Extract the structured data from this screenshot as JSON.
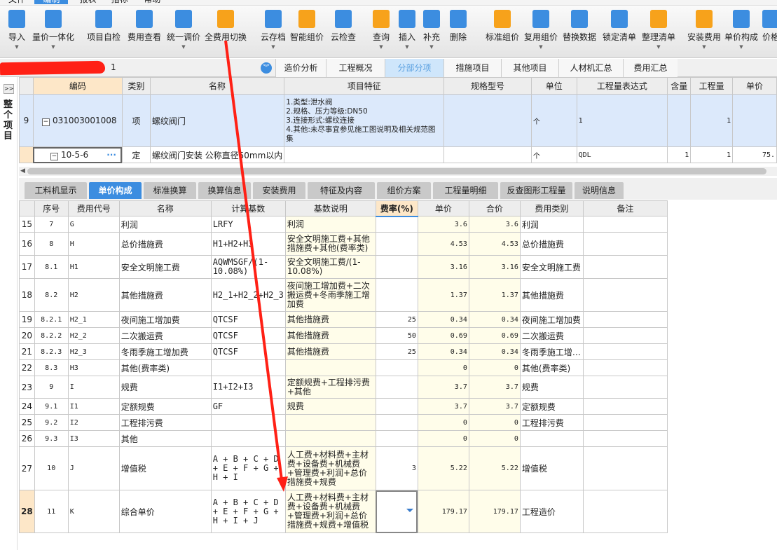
{
  "menu": [
    "文件",
    "编制",
    "报表",
    "指标",
    "帮助"
  ],
  "menu_active": 1,
  "toolbar": [
    {
      "label": "导入",
      "icon": "import-icon",
      "color": "#3c8de0",
      "dropdown": true
    },
    {
      "label": "量价一体化",
      "icon": "quantity-price-icon",
      "color": "#3c8de0",
      "dropdown": true
    },
    {
      "label": "项目自检",
      "icon": "project-check-icon",
      "color": "#3c8de0",
      "dropdown": false
    },
    {
      "label": "费用查看",
      "icon": "cost-view-icon",
      "color": "#3c8de0",
      "dropdown": false
    },
    {
      "label": "统一调价",
      "icon": "unified-price-adjust-icon",
      "color": "#3c8de0",
      "dropdown": true
    },
    {
      "label": "全费用切换",
      "icon": "full-cost-switch-icon",
      "color": "#f7a21b",
      "dropdown": false
    },
    {
      "label": "云存档",
      "icon": "cloud-save-icon",
      "color": "#3c8de0",
      "dropdown": true
    },
    {
      "label": "智能组价",
      "icon": "smart-pricing-icon",
      "color": "#f7a21b",
      "dropdown": false
    },
    {
      "label": "云检查",
      "icon": "cloud-check-icon",
      "color": "#3c8de0",
      "dropdown": false
    },
    {
      "label": "查询",
      "icon": "search-icon",
      "color": "#f7a21b",
      "dropdown": true
    },
    {
      "label": "插入",
      "icon": "insert-icon",
      "color": "#3c8de0",
      "dropdown": true
    },
    {
      "label": "补充",
      "icon": "supplement-icon",
      "color": "#3c8de0",
      "dropdown": true
    },
    {
      "label": "删除",
      "icon": "delete-icon",
      "color": "#3c8de0",
      "dropdown": false
    },
    {
      "label": "标准组价",
      "icon": "standard-pricing-icon",
      "color": "#f7a21b",
      "dropdown": false
    },
    {
      "label": "复用组价",
      "icon": "reuse-pricing-icon",
      "color": "#3c8de0",
      "dropdown": true
    },
    {
      "label": "替换数据",
      "icon": "replace-data-icon",
      "color": "#3c8de0",
      "dropdown": false
    },
    {
      "label": "锁定清单",
      "icon": "lock-icon",
      "color": "#3c8de0",
      "dropdown": false
    },
    {
      "label": "整理清单",
      "icon": "organize-list-icon",
      "color": "#f7a21b",
      "dropdown": true
    },
    {
      "label": "安装费用",
      "icon": "install-cost-icon",
      "color": "#f7a21b",
      "dropdown": true
    },
    {
      "label": "单价构成",
      "icon": "unit-price-composition-icon",
      "color": "#3c8de0",
      "dropdown": true
    },
    {
      "label": "价格",
      "icon": "price-icon",
      "color": "#3c8de0",
      "dropdown": false
    }
  ],
  "project_suffix": "1",
  "main_tabs": [
    "造价分析",
    "工程概况",
    "分部分项",
    "措施项目",
    "其他项目",
    "人材机汇总",
    "费用汇总"
  ],
  "main_tab_active": 2,
  "left_pane": {
    "expand": ">>",
    "title": "整个项目"
  },
  "upper_table": {
    "headers": [
      "",
      "编码",
      "类别",
      "名称",
      "项目特征",
      "规格型号",
      "单位",
      "工程量表达式",
      "含量",
      "工程量",
      "单价"
    ],
    "rows": [
      {
        "no": "9",
        "code": "031003001008",
        "type": "项",
        "name": "螺纹阀门",
        "features": [
          "1.类型:泄水阀",
          "2.规格、压力等级:DN50",
          "3.连接形式:螺纹连接",
          "4.其他:未尽事宜参见施工图说明及相关规范图集"
        ],
        "spec": "",
        "unit": "个",
        "expr": "1",
        "content": "",
        "qty": "1",
        "price": ""
      },
      {
        "no": "",
        "code": "10-5-6",
        "type": "定",
        "name": "螺纹阀门安装 公称直径50mm以内",
        "features": [],
        "spec": "",
        "unit": "个",
        "expr": "QDL",
        "content": "1",
        "qty": "1",
        "price": "75."
      }
    ]
  },
  "bottom_tabs": [
    "工料机显示",
    "单价构成",
    "标准换算",
    "换算信息",
    "安装费用",
    "特征及内容",
    "组价方案",
    "工程量明细",
    "反查图形工程量",
    "说明信息"
  ],
  "bottom_tab_active": 1,
  "lower_table": {
    "headers": [
      "",
      "序号",
      "费用代号",
      "名称",
      "计算基数",
      "基数说明",
      "费率(%)",
      "单价",
      "合价",
      "费用类别",
      "备注"
    ],
    "rows": [
      [
        "15",
        "7",
        "G",
        "利润",
        "LRFY",
        "利润",
        "",
        "3.6",
        "3.6",
        "利润",
        ""
      ],
      [
        "16",
        "8",
        "H",
        "总价措施费",
        "H1+H2+H3",
        "安全文明施工费+其他措施费+其他(费率类)",
        "",
        "4.53",
        "4.53",
        "总价措施费",
        ""
      ],
      [
        "17",
        "8.1",
        "H1",
        "安全文明施工费",
        "AQWMSGF/(1-10.08%)",
        "安全文明施工费/(1-10.08%)",
        "",
        "3.16",
        "3.16",
        "安全文明施工费",
        ""
      ],
      [
        "18",
        "8.2",
        "H2",
        "其他措施费",
        "H2_1+H2_2+H2_3",
        "夜间施工增加费+二次搬运费+冬雨季施工增加费",
        "",
        "1.37",
        "1.37",
        "其他措施费",
        ""
      ],
      [
        "19",
        "8.2.1",
        "H2_1",
        "夜间施工增加费",
        "QTCSF",
        "其他措施费",
        "25",
        "0.34",
        "0.34",
        "夜间施工增加费",
        ""
      ],
      [
        "20",
        "8.2.2",
        "H2_2",
        "二次搬运费",
        "QTCSF",
        "其他措施费",
        "50",
        "0.69",
        "0.69",
        "二次搬运费",
        ""
      ],
      [
        "21",
        "8.2.3",
        "H2_3",
        "冬雨季施工增加费",
        "QTCSF",
        "其他措施费",
        "25",
        "0.34",
        "0.34",
        "冬雨季施工增…",
        ""
      ],
      [
        "22",
        "8.3",
        "H3",
        "其他(费率类)",
        "",
        "",
        "",
        "0",
        "0",
        "其他(费率类)",
        ""
      ],
      [
        "23",
        "9",
        "I",
        "规费",
        "I1+I2+I3",
        "定额规费+工程排污费+其他",
        "",
        "3.7",
        "3.7",
        "规费",
        ""
      ],
      [
        "24",
        "9.1",
        "I1",
        "定额规费",
        "GF",
        "规费",
        "",
        "3.7",
        "3.7",
        "定额规费",
        ""
      ],
      [
        "25",
        "9.2",
        "I2",
        "工程排污费",
        "",
        "",
        "",
        "0",
        "0",
        "工程排污费",
        ""
      ],
      [
        "26",
        "9.3",
        "I3",
        "其他",
        "",
        "",
        "",
        "0",
        "0",
        "",
        ""
      ],
      [
        "27",
        "10",
        "J",
        "增值税",
        "A + B + C + D + E + F + G + H + I",
        "人工费+材料费+主材费+设备费+机械费+管理费+利润+总价措施费+规费",
        "3",
        "5.22",
        "5.22",
        "增值税",
        ""
      ],
      [
        "28",
        "11",
        "K",
        "综合单价",
        "A + B + C + D + E + F + G + H + I + J",
        "人工费+材料费+主材费+设备费+机械费+管理费+利润+总价措施费+规费+增值税",
        "",
        "179.17",
        "179.17",
        "工程造价",
        ""
      ]
    ],
    "selected_row": "28"
  },
  "annotation_color": "#ff2015"
}
